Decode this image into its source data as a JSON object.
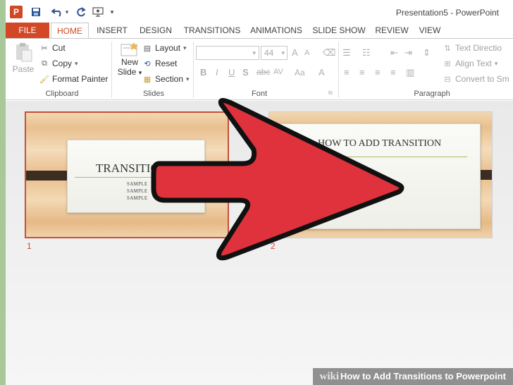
{
  "window": {
    "title": "Presentation5 - PowerPoint",
    "app_badge": "P"
  },
  "quick_access": {
    "save_icon": "💾",
    "undo_icon": "↶",
    "redo_icon": "↻",
    "present_icon": "▣",
    "customize_icon": "▾"
  },
  "tabs": [
    "FILE",
    "HOME",
    "INSERT",
    "DESIGN",
    "TRANSITIONS",
    "ANIMATIONS",
    "SLIDE SHOW",
    "REVIEW",
    "VIEW"
  ],
  "ribbon": {
    "clipboard": {
      "paste": "Paste",
      "cut": "Cut",
      "copy": "Copy",
      "format_painter": "Format Painter",
      "label": "Clipboard"
    },
    "slides": {
      "new_slide_1": "New",
      "new_slide_2": "Slide",
      "layout": "Layout",
      "reset": "Reset",
      "section": "Section",
      "label": "Slides"
    },
    "font": {
      "size": "44",
      "label": "Font",
      "bold": "B",
      "italic": "I",
      "underline": "U",
      "shadow": "S",
      "spacing": "AV",
      "case": "Aa",
      "color": "A",
      "grow": "A",
      "shrink": "A"
    },
    "paragraph": {
      "text_direction": "Text Directio",
      "align_text": "Align Text",
      "convert": "Convert to Sm",
      "label": "Paragraph"
    }
  },
  "slides": [
    {
      "number": "1",
      "title": "TRANSITIO",
      "lines": [
        "SAMPLE",
        "SAMPLE",
        "SAMPLE"
      ]
    },
    {
      "number": "2",
      "title": "HOW TO ADD TRANSITION"
    }
  ],
  "watermark": {
    "brand": "wiki",
    "text": "How to Add Transitions to Powerpoint"
  },
  "colors": {
    "accent": "#d24726",
    "arrow_fill": "#e0323c",
    "selection_border": "#c5503a"
  }
}
